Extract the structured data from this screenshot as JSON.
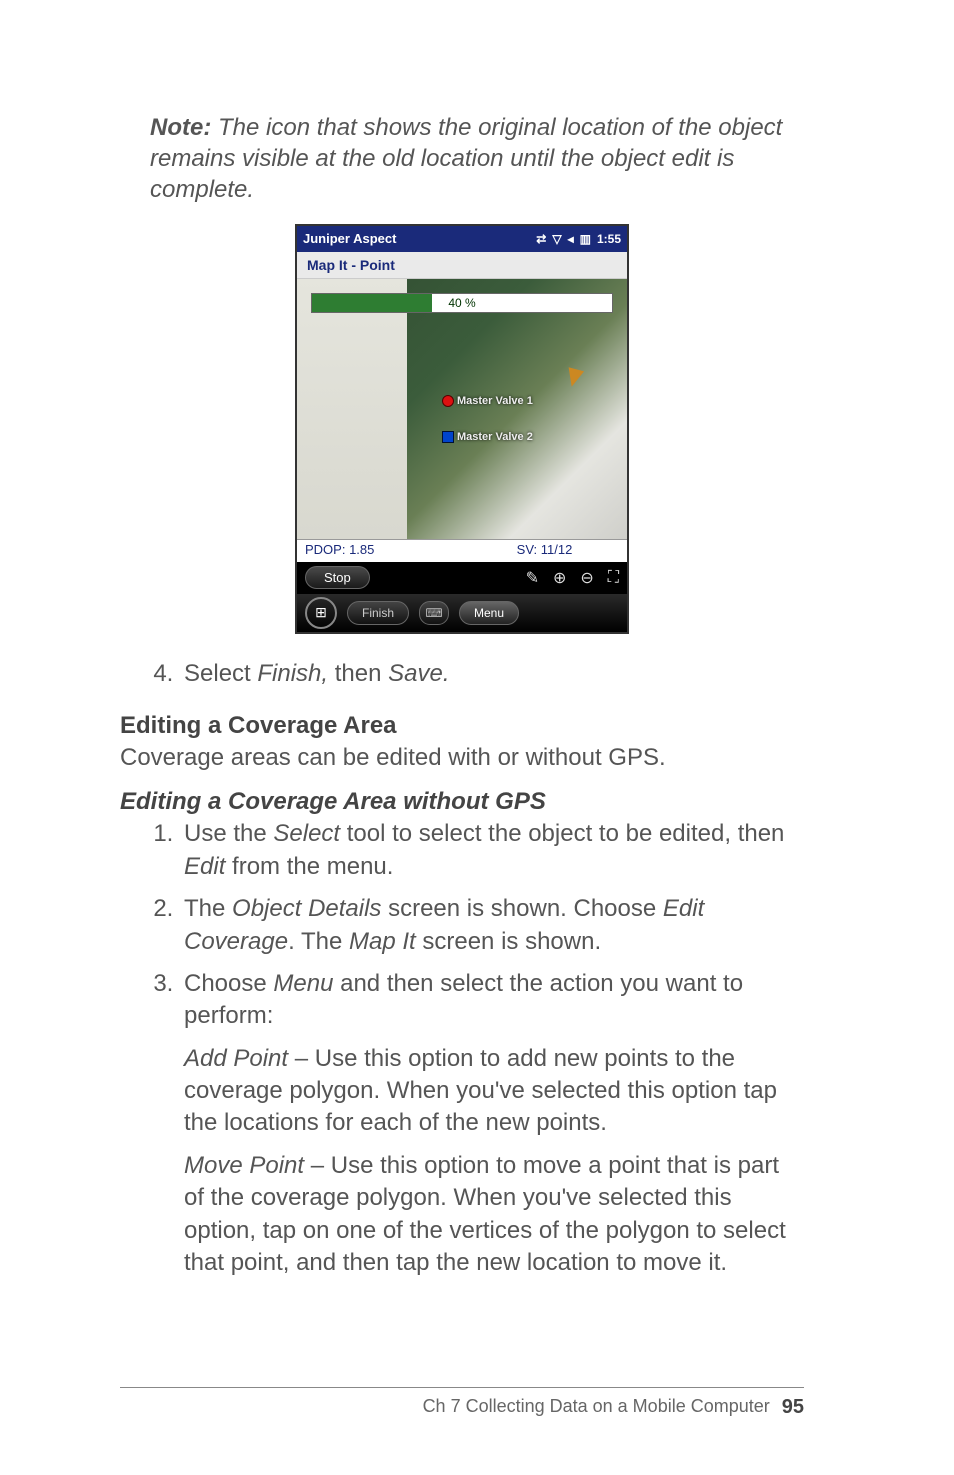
{
  "note": {
    "label": "Note:",
    "text": " The icon that shows the original location of the object remains visible at the old location until the object edit is complete."
  },
  "screenshot": {
    "title": "Juniper Aspect",
    "clock": "1:55",
    "subtitle": "Map It - Point",
    "progress_pct": "40 %",
    "mv1": "Master Valve 1",
    "mv2": "Master Valve 2",
    "pdop": "PDOP: 1.85",
    "sv": "SV: 11/12",
    "stop": "Stop",
    "finish": "Finish",
    "menu": "Menu"
  },
  "step4": {
    "pre": "Select ",
    "em1": "Finish,",
    "mid": " then ",
    "em2": "Save."
  },
  "sectionA": {
    "title": "Editing a Coverage Area",
    "text": "Coverage areas can be edited with or without GPS."
  },
  "sectionB": {
    "title": "Editing a Coverage Area without GPS"
  },
  "steps": {
    "s1": {
      "a": "Use the ",
      "select": "Select",
      "b": " tool to select the object to be edited, then ",
      "edit": "Edit",
      "c": " from the menu."
    },
    "s2": {
      "a": "The ",
      "od": "Object Details",
      "b": " screen is shown. Choose ",
      "ec": "Edit Coverage",
      "c": ". The ",
      "mi": "Map It",
      "d": " screen is shown."
    },
    "s3": {
      "a": "Choose ",
      "menu": "Menu",
      "b": " and then select the action you want to perform:"
    },
    "add": {
      "t": "Add Point",
      "body": " – Use this option to add new points to the coverage polygon. When you've selected this option tap the locations for each of the new points."
    },
    "move": {
      "t": "Move Point",
      "body": " – Use this option to move a point that is part of the coverage polygon. When you've selected this option, tap on one of the vertices of the polygon to select that point, and then tap the new location to move it."
    }
  },
  "footer": {
    "chapter": "Ch 7   Collecting Data on a Mobile Computer",
    "page": "95"
  }
}
